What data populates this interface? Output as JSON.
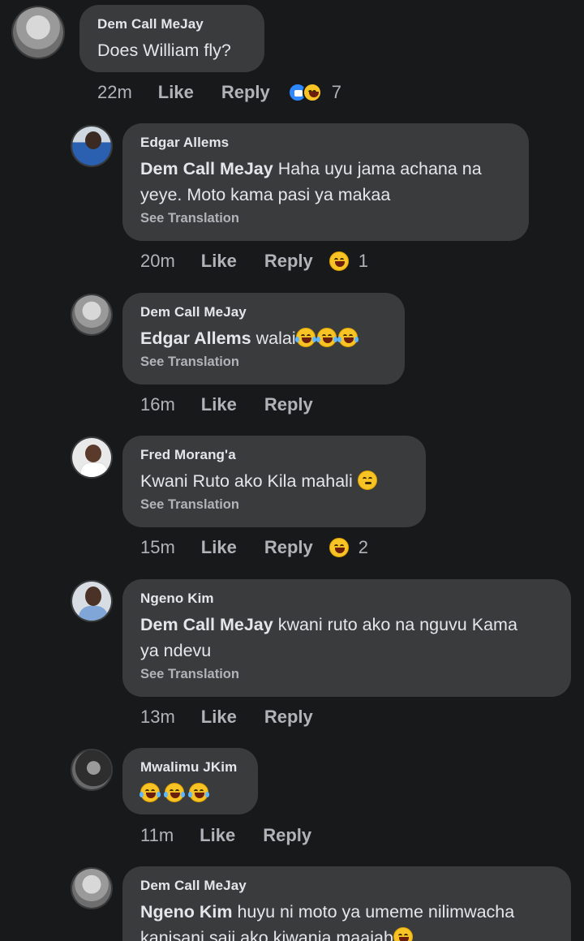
{
  "comments": [
    {
      "author": "Dem Call MeJay",
      "text": "Does William fly?",
      "time": "22m",
      "like_label": "Like",
      "reply_label": "Reply",
      "reaction_count": "7",
      "reactions": [
        "like-icon",
        "haha-icon"
      ]
    },
    {
      "author": "Edgar Allems",
      "mention": "Dem Call MeJay",
      "text_line1": " Haha uyu jama achana na",
      "text_line2": "yeye. Moto kama pasi ya makaa",
      "see_translation": "See Translation",
      "time": "20m",
      "like_label": "Like",
      "reply_label": "Reply",
      "reaction_count": "1",
      "reactions": [
        "haha-icon"
      ]
    },
    {
      "author": "Dem Call MeJay",
      "mention": "Edgar Allems",
      "text": " walai",
      "emojis": [
        "rofl",
        "rofl",
        "rofl"
      ],
      "see_translation": "See Translation",
      "time": "16m",
      "like_label": "Like",
      "reply_label": "Reply"
    },
    {
      "author": "Fred Morang'a",
      "text": "Kwani Ruto ako Kila mahali ",
      "emojis": [
        "thinking"
      ],
      "see_translation": "See Translation",
      "time": "15m",
      "like_label": "Like",
      "reply_label": "Reply",
      "reaction_count": "2",
      "reactions": [
        "haha-icon"
      ]
    },
    {
      "author": "Ngeno Kim",
      "mention": "Dem Call MeJay",
      "text_line1": " kwani ruto ako na nguvu Kama",
      "text_line2": "ya ndevu",
      "see_translation": "See Translation",
      "time": "13m",
      "like_label": "Like",
      "reply_label": "Reply"
    },
    {
      "author": "Mwalimu JKim",
      "emojis": [
        "joy",
        "joy",
        "joy"
      ],
      "time": "11m",
      "like_label": "Like",
      "reply_label": "Reply"
    },
    {
      "author": "Dem Call MeJay",
      "mention": "Ngeno Kim",
      "text_line1": " huyu ni moto ya umeme nilimwacha",
      "text_line2": "kanisani saii ako kiwanja maajab",
      "emojis": [
        "smile"
      ]
    }
  ],
  "colors": {
    "background": "#18191a",
    "bubble": "#3a3b3c",
    "text": "#e4e6eb",
    "muted": "#b0b3b8",
    "like_blue": "#2d88ff",
    "emoji_yellow": "#f7c325"
  }
}
